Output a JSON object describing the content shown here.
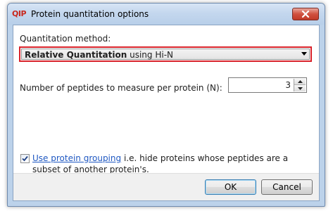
{
  "window": {
    "app_icon_text": "QIP",
    "title": "Protein quantitation options",
    "close_icon": "close-icon"
  },
  "method": {
    "label": "Quantitation method:",
    "selected_bold": "Relative Quantitation",
    "selected_rest": " using Hi-N",
    "highlight_color": "#d9232b"
  },
  "peptides": {
    "label": "Number of peptides to measure per protein (N):",
    "value": "3"
  },
  "grouping": {
    "checked": true,
    "link_text": "Use protein grouping",
    "description": " i.e. hide proteins whose peptides are a subset of another protein's."
  },
  "buttons": {
    "ok": "OK",
    "cancel": "Cancel"
  }
}
